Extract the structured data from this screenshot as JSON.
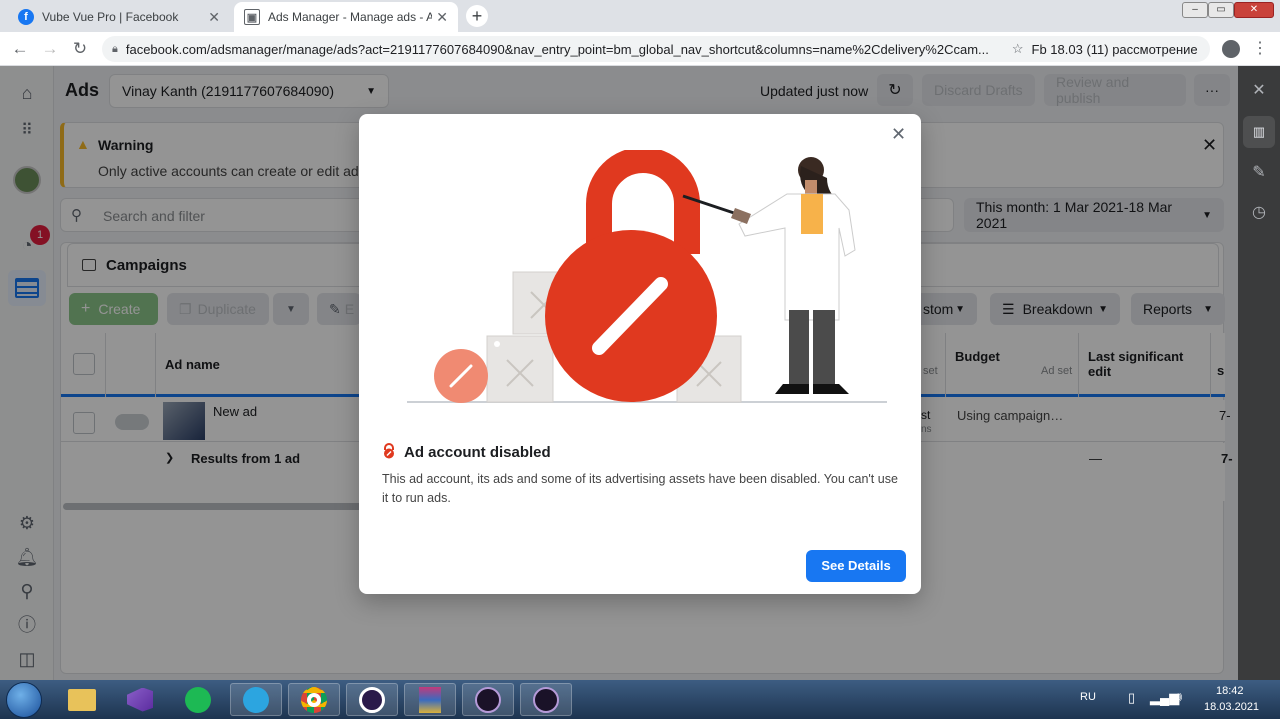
{
  "browser": {
    "tabs": [
      {
        "title": "Vube Vue Pro | Facebook",
        "active": false
      },
      {
        "title": "Ads Manager - Manage ads - Ad",
        "active": true
      }
    ],
    "url": "facebook.com/adsmanager/manage/ads?act=2191177607684090&nav_entry_point=bm_global_nav_shortcut&columns=name%2Cdelivery%2Ccam...",
    "bookmark": "Fb 18.03 (11) рассмотрение"
  },
  "leftnav": {
    "notification_count": "1"
  },
  "header": {
    "title": "Ads",
    "account": "Vinay Kanth (2191177607684090)",
    "updated": "Updated just now",
    "discard": "Discard Drafts",
    "review": "Review and publish"
  },
  "warning": {
    "title": "Warning",
    "body": "Only active accounts can create or edit ads."
  },
  "search": {
    "placeholder": "Search and filter",
    "date": "This month: 1 Mar 2021-18 Mar 2021"
  },
  "campaigns": {
    "label": "Campaigns"
  },
  "toolbar": {
    "create": "Create",
    "duplicate": "Duplicate",
    "edit_partial": "E",
    "custom_partial": "stom",
    "breakdown": "Breakdown",
    "reports": "Reports"
  },
  "table": {
    "col_name": "Ad name",
    "col_set_partial": "set",
    "col_budget": "Budget",
    "col_budget_sub": "Ad set",
    "col_last_edit": "Last significant edit",
    "col_next_partial": "s",
    "row_name": "New ad",
    "row_partial_a": "st",
    "row_partial_b": "ns",
    "row_budget": "Using campaign…",
    "row_next": "7-",
    "results": "Results from 1 ad",
    "results_edit": "—",
    "results_next": "7-"
  },
  "modal": {
    "title": "Ad account disabled",
    "body": "This ad account, its ads and some of its advertising assets have been disabled. You can't use it to run ads.",
    "cta": "See Details"
  },
  "taskbar": {
    "lang": "RU",
    "time": "18:42",
    "date": "18.03.2021"
  },
  "colors": {
    "fb_blue": "#1877f2",
    "warning_yellow": "#f7b928",
    "lock_red": "#e0391f",
    "create_green": "#8cc78a"
  }
}
